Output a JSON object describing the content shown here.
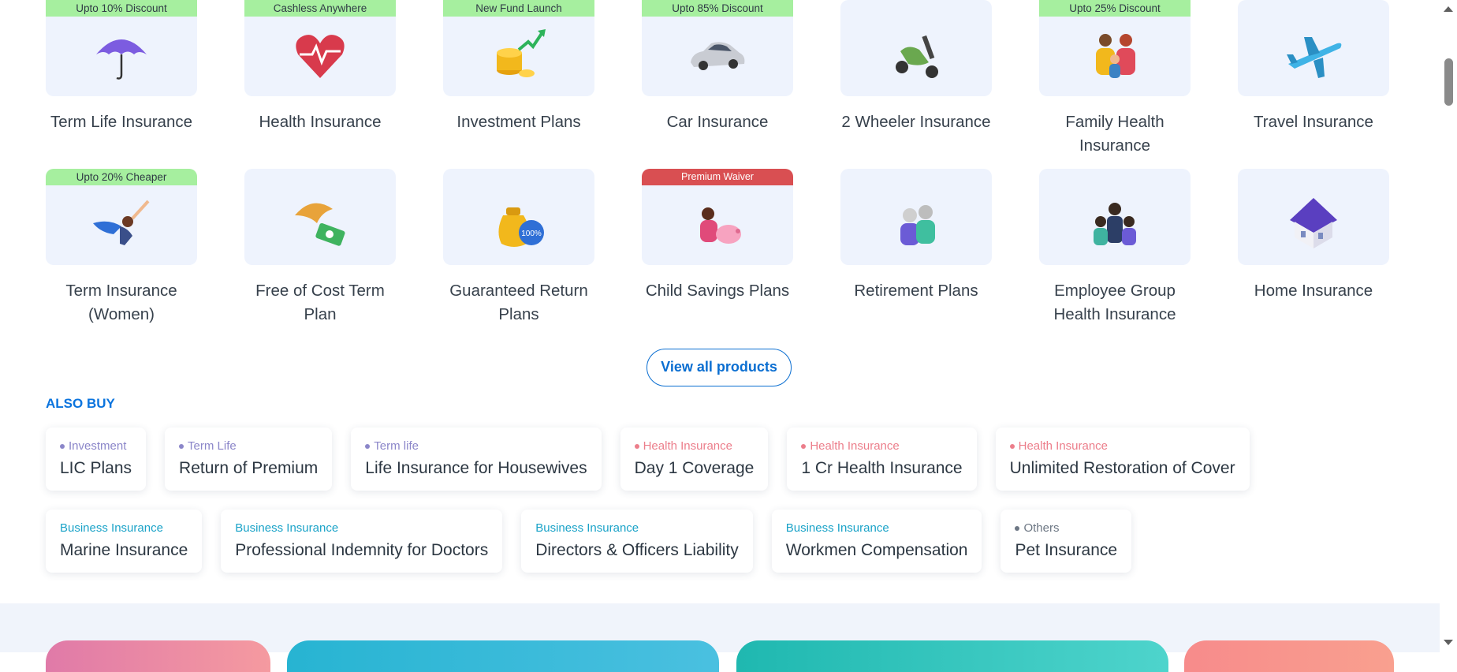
{
  "products_row1": [
    {
      "badge": "Upto 10% Discount",
      "title": "Term Life Insurance",
      "icon": "umbrella-icon"
    },
    {
      "badge": "Cashless Anywhere",
      "title": "Health Insurance",
      "icon": "heart-icon"
    },
    {
      "badge": "New Fund Launch",
      "title": "Investment Plans",
      "icon": "coins-growth-icon"
    },
    {
      "badge": "Upto 85% Discount",
      "title": "Car Insurance",
      "icon": "car-icon"
    },
    {
      "badge": "",
      "title": "2 Wheeler Insurance",
      "icon": "scooter-icon"
    },
    {
      "badge": "Upto 25% Discount",
      "title": "Family Health Insurance",
      "icon": "family-icon"
    },
    {
      "badge": "",
      "title": "Travel Insurance",
      "icon": "airplane-icon"
    }
  ],
  "products_row2": [
    {
      "badge": "Upto 20% Cheaper",
      "title": "Term Insurance (Women)",
      "icon": "superwoman-icon"
    },
    {
      "badge": "",
      "title": "Free of Cost Term Plan",
      "icon": "umbrella-money-icon"
    },
    {
      "badge": "",
      "title": "Guaranteed Return Plans",
      "icon": "money-bag-icon"
    },
    {
      "badge": "Premium Waiver",
      "title": "Child Savings Plans",
      "icon": "piggy-bank-icon"
    },
    {
      "badge": "",
      "title": "Retirement Plans",
      "icon": "elderly-couple-icon"
    },
    {
      "badge": "",
      "title": "Employee Group Health Insurance",
      "icon": "group-icon"
    },
    {
      "badge": "",
      "title": "Home Insurance",
      "icon": "house-icon"
    }
  ],
  "view_all": "View all products",
  "also_buy": {
    "title": "ALSO BUY",
    "row1": [
      {
        "tag": "Investment",
        "name": "LIC Plans",
        "color": "purple"
      },
      {
        "tag": "Term Life",
        "name": "Return of Premium",
        "color": "purple"
      },
      {
        "tag": "Term life",
        "name": "Life Insurance for Housewives",
        "color": "purple"
      },
      {
        "tag": "Health Insurance",
        "name": "Day 1 Coverage",
        "color": "pink"
      },
      {
        "tag": "Health Insurance",
        "name": "1 Cr Health Insurance",
        "color": "pink"
      },
      {
        "tag": "Health Insurance",
        "name": "Unlimited Restoration of Cover",
        "color": "pink"
      }
    ],
    "row2": [
      {
        "tag": "Business Insurance",
        "name": "Marine Insurance",
        "color": "teal"
      },
      {
        "tag": "Business Insurance",
        "name": "Professional Indemnity for Doctors",
        "color": "teal"
      },
      {
        "tag": "Business Insurance",
        "name": "Directors & Officers Liability",
        "color": "teal"
      },
      {
        "tag": "Business Insurance",
        "name": "Workmen Compensation",
        "color": "teal"
      },
      {
        "tag": "Others",
        "name": "Pet Insurance",
        "color": "grey"
      }
    ]
  },
  "colors": {
    "accent": "#0b74de",
    "badge_green": "#a6ef9f",
    "badge_red": "#d94f52",
    "tile_bg": "#eef3fd"
  }
}
